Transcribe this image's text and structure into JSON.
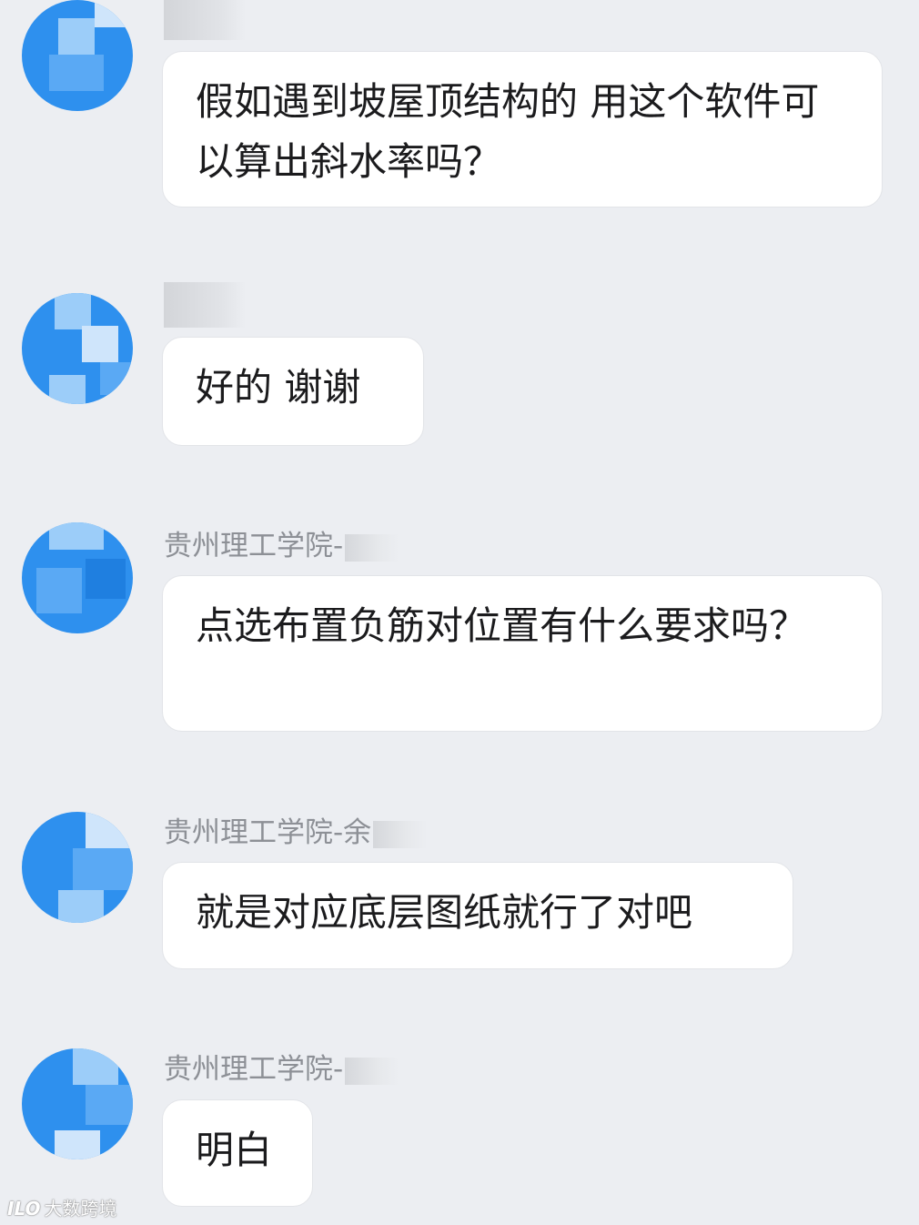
{
  "messages": [
    {
      "sender": "",
      "text": "假如遇到坡屋顶结构的  用这个软件可以算出斜水率吗？"
    },
    {
      "sender": "",
      "text": "好的  谢谢"
    },
    {
      "sender": "贵州理工学院-",
      "text": "点选布置负筋对位置有什么要求吗？"
    },
    {
      "sender": "贵州理工学院-余",
      "text": "就是对应底层图纸就行了对吧"
    },
    {
      "sender": "贵州理工学院-",
      "text": "明白"
    }
  ],
  "watermark": {
    "logo": "ILO",
    "text": "大数跨境"
  },
  "colors": {
    "background": "#eceef2",
    "bubble": "#ffffff",
    "avatar": "#2e90ee",
    "sender_text": "#8d9096"
  }
}
